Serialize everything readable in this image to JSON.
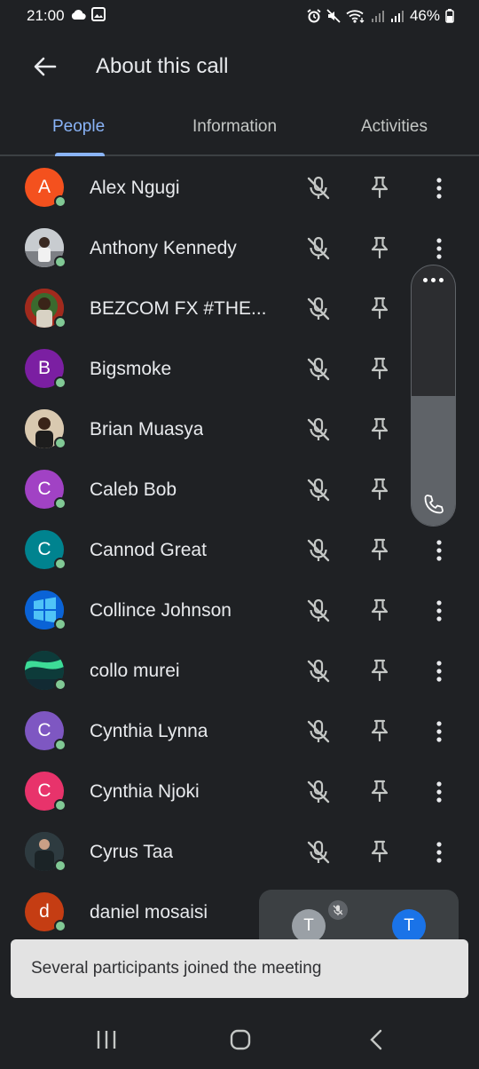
{
  "status_bar": {
    "time": "21:00",
    "battery": "46%",
    "icons": [
      "cloud-icon",
      "image-icon",
      "alarm-icon",
      "mute-icon",
      "wifi-icon",
      "signal-icon",
      "signal-icon",
      "battery-icon"
    ]
  },
  "header": {
    "title": "About this call",
    "back_icon": "arrow-back-icon"
  },
  "tabs": [
    {
      "label": "People",
      "active": true
    },
    {
      "label": "Information",
      "active": false
    },
    {
      "label": "Activities",
      "active": false
    }
  ],
  "participants": [
    {
      "name": "Alex Ngugi",
      "initial": "A",
      "avatar_color": "#f4511e",
      "avatar_type": "initial"
    },
    {
      "name": "Anthony Kennedy",
      "initial": "",
      "avatar_color": "#9aa0a6",
      "avatar_type": "photo"
    },
    {
      "name": "BEZCOM FX #THE...",
      "initial": "",
      "avatar_color": "#8d3b2b",
      "avatar_type": "photo"
    },
    {
      "name": "Bigsmoke",
      "initial": "B",
      "avatar_color": "#7b1fa2",
      "avatar_type": "initial"
    },
    {
      "name": "Brian Muasya",
      "initial": "",
      "avatar_color": "#b9a38a",
      "avatar_type": "photo"
    },
    {
      "name": "Caleb Bob",
      "initial": "C",
      "avatar_color": "#a142c4",
      "avatar_type": "initial"
    },
    {
      "name": "Cannod Great",
      "initial": "C",
      "avatar_color": "#00838f",
      "avatar_type": "initial"
    },
    {
      "name": "Collince Johnson",
      "initial": "",
      "avatar_color": "#1565c0",
      "avatar_type": "photo"
    },
    {
      "name": "collo murei",
      "initial": "",
      "avatar_color": "#1b5e55",
      "avatar_type": "photo"
    },
    {
      "name": "Cynthia Lynna",
      "initial": "C",
      "avatar_color": "#7e57c2",
      "avatar_type": "initial"
    },
    {
      "name": "Cynthia Njoki",
      "initial": "C",
      "avatar_color": "#e8336b",
      "avatar_type": "initial"
    },
    {
      "name": "Cyrus Taa",
      "initial": "",
      "avatar_color": "#37474f",
      "avatar_type": "photo"
    },
    {
      "name": "daniel mosaisi",
      "initial": "d",
      "avatar_color": "#c53d13",
      "avatar_type": "initial"
    }
  ],
  "row_icons": {
    "mic": "mic-off-icon",
    "pin": "pin-icon",
    "more": "more-vert-icon"
  },
  "call_panel": {
    "icons": [
      "more-horiz-icon",
      "phone-icon"
    ]
  },
  "mini_tiles": [
    {
      "initial": "T",
      "color": "#9aa0a6"
    },
    {
      "initial": "T",
      "color": "#1a73e8"
    }
  ],
  "snackbar": {
    "text": "Several participants joined the meeting"
  },
  "nav_bar": {
    "icons": [
      "recents-icon",
      "home-icon",
      "back-icon"
    ]
  },
  "colors": {
    "accent": "#8ab4f8",
    "background": "#1f2124",
    "online": "#81c995"
  }
}
